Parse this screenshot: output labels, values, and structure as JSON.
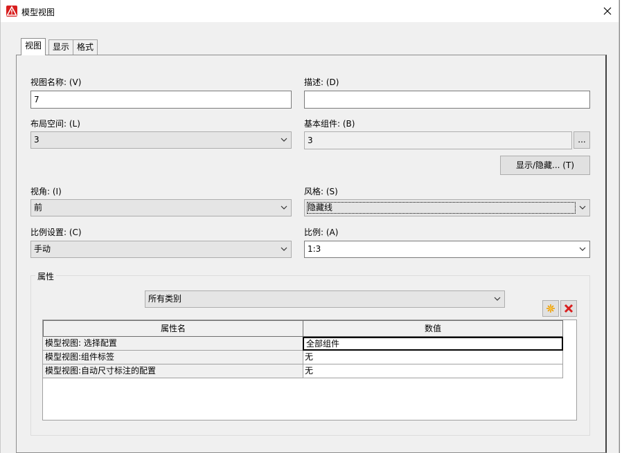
{
  "window": {
    "title": "模型视图"
  },
  "tabs": [
    {
      "label": "视图",
      "active": true
    },
    {
      "label": "显示",
      "active": false
    },
    {
      "label": "格式",
      "active": false
    }
  ],
  "form": {
    "view_name_label": "视图名称: (V)",
    "view_name_value": "7",
    "description_label": "描述: (D)",
    "description_value": "",
    "layout_space_label": "布局空间: (L)",
    "layout_space_value": "3",
    "base_component_label": "基本组件: (B)",
    "base_component_value": "3",
    "browse_label": "...",
    "show_hide_label": "显示/隐藏... (T)",
    "view_angle_label": "视角: (I)",
    "view_angle_value": "前",
    "style_label": "风格: (S)",
    "style_value": "隐藏线",
    "scale_setting_label": "比例设置: (C)",
    "scale_setting_value": "手动",
    "scale_label": "比例: (A)",
    "scale_value": "1:3"
  },
  "properties": {
    "group_label": "属性",
    "category_value": "所有类别",
    "columns": [
      "属性名",
      "数值"
    ],
    "rows": [
      {
        "name": "模型视图: 选择配置",
        "value": "全部组件"
      },
      {
        "name": "模型视图:组件标签",
        "value": "无"
      },
      {
        "name": "模型视图:自动尺寸标注的配置",
        "value": "无"
      }
    ]
  },
  "colors": {
    "accent_red": "#d81e1e",
    "star_orange": "#f0a000"
  }
}
